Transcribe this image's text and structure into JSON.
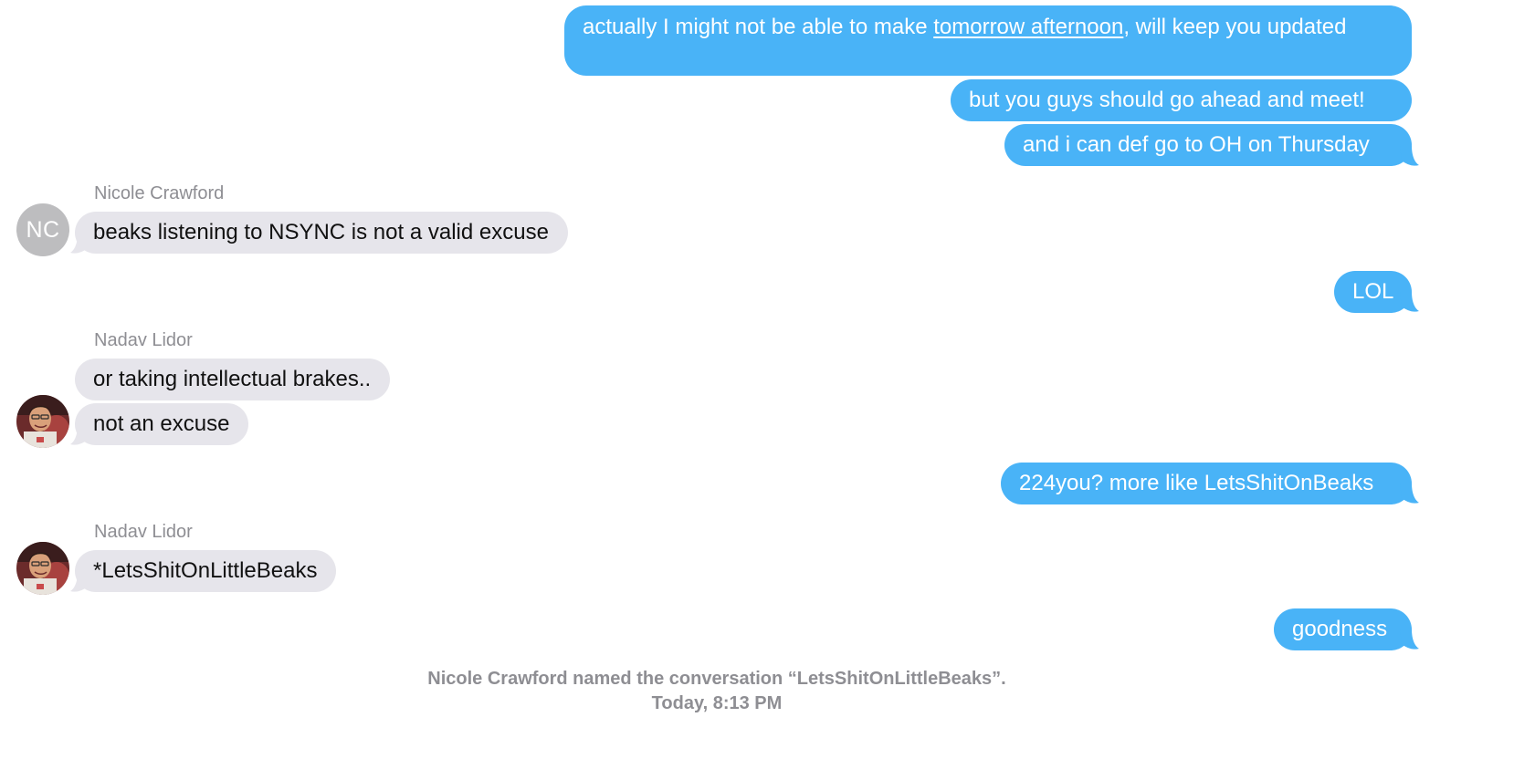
{
  "colors": {
    "outgoing_bubble": "#49b3f7",
    "incoming_bubble": "#e6e5eb",
    "meta_text": "#8e8e93",
    "avatar_placeholder": "#bdbdbf"
  },
  "messages": {
    "m1": {
      "before": "actually I might not be able to make ",
      "link": "tomorrow afternoon",
      "after": ", will keep you updated"
    },
    "m2": "but you guys should go ahead and meet!",
    "m3": "and i can def go to OH on Thursday",
    "m4_sender": "Nicole Crawford",
    "m4_avatar_initials": "NC",
    "m4": "beaks listening to NSYNC is not a valid excuse",
    "m5": "LOL",
    "m6_sender": "Nadav Lidor",
    "m6": "or taking intellectual brakes..",
    "m7": "not an excuse",
    "m8": "224you? more like LetsShitOnBeaks",
    "m9_sender": "Nadav Lidor",
    "m9": "*LetsShitOnLittleBeaks",
    "m10": "goodness"
  },
  "system_notice": {
    "text": "Nicole Crawford named the conversation “LetsShitOnLittleBeaks”.",
    "timestamp": "Today, 8:13 PM"
  }
}
